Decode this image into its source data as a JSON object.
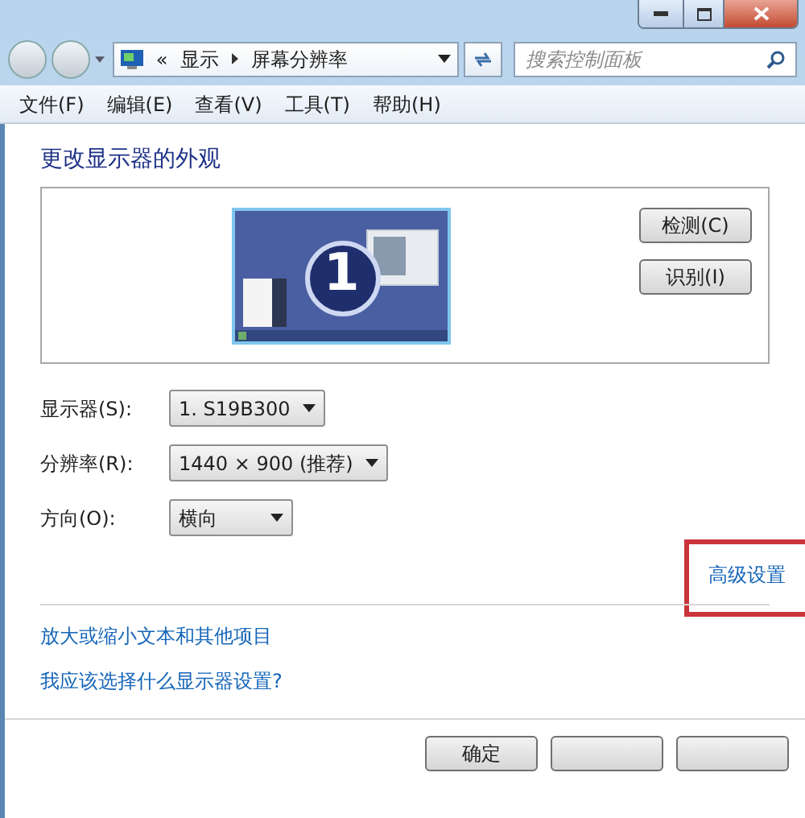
{
  "address_bar": {
    "path": [
      {
        "label": "«"
      },
      {
        "label": "显示"
      },
      {
        "label": "屏幕分辨率"
      }
    ]
  },
  "search": {
    "placeholder": "搜索控制面板"
  },
  "menu": [
    "文件(F)",
    "编辑(E)",
    "查看(V)",
    "工具(T)",
    "帮助(H)"
  ],
  "heading": "更改显示器的外观",
  "preview": {
    "monitor_number": "1",
    "buttons": [
      "检测(C)",
      "识别(I)"
    ]
  },
  "settings": [
    {
      "label": "显示器(S):",
      "value": "1. S19B300"
    },
    {
      "label": "分辨率(R):",
      "value": "1440 × 900 (推荐)"
    },
    {
      "label": "方向(O):",
      "value": "横向"
    }
  ],
  "advanced_link": {
    "label": "高级设置",
    "highlighted": true
  },
  "links": [
    "放大或缩小文本和其他项目",
    "我应该选择什么显示器设置?"
  ],
  "buttons": [
    {
      "kind": "text",
      "label": "确定"
    },
    {
      "kind": "blank"
    },
    {
      "kind": "blank"
    }
  ]
}
